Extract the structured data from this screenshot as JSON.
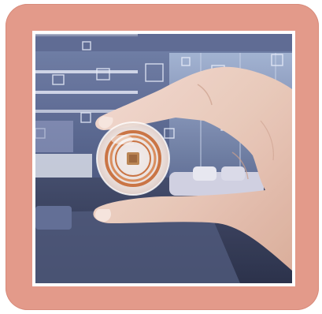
{
  "image": {
    "subject": "",
    "frame_color": "#e39a8a",
    "accent_copper": "#c8703e",
    "room_tone": "#3f4a6e"
  }
}
